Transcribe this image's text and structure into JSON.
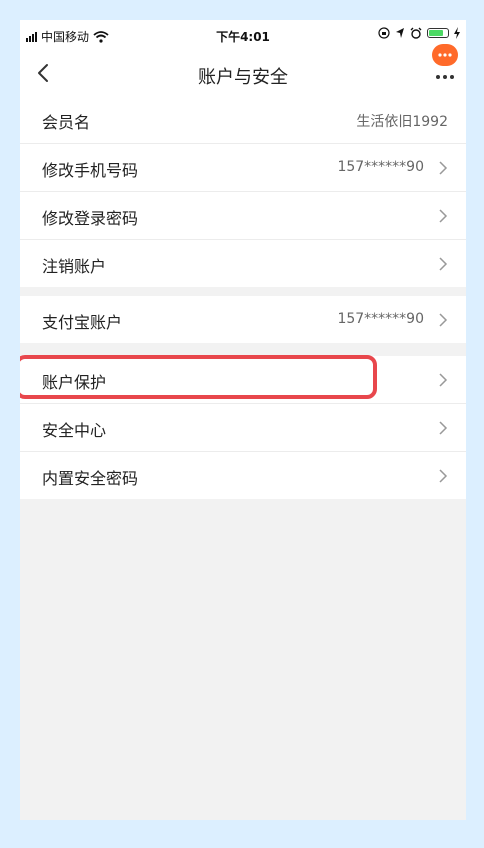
{
  "status_bar": {
    "carrier": "中国移动",
    "time": "下午4:01"
  },
  "nav": {
    "title": "账户与安全"
  },
  "section1": [
    {
      "label": "会员名",
      "value": "生活依旧1992",
      "chevron": false
    },
    {
      "label": "修改手机号码",
      "value": "157******90",
      "chevron": true
    },
    {
      "label": "修改登录密码",
      "value": "",
      "chevron": true
    },
    {
      "label": "注销账户",
      "value": "",
      "chevron": true
    }
  ],
  "section2": [
    {
      "label": "支付宝账户",
      "value": "157******90",
      "chevron": true
    }
  ],
  "section3": [
    {
      "label": "账户保护",
      "value": "",
      "chevron": true
    },
    {
      "label": "安全中心",
      "value": "",
      "chevron": true
    },
    {
      "label": "内置安全密码",
      "value": "",
      "chevron": true
    }
  ],
  "colors": {
    "highlight": "#e8474c",
    "accent": "#ff6a2a",
    "battery": "#4cd964"
  }
}
